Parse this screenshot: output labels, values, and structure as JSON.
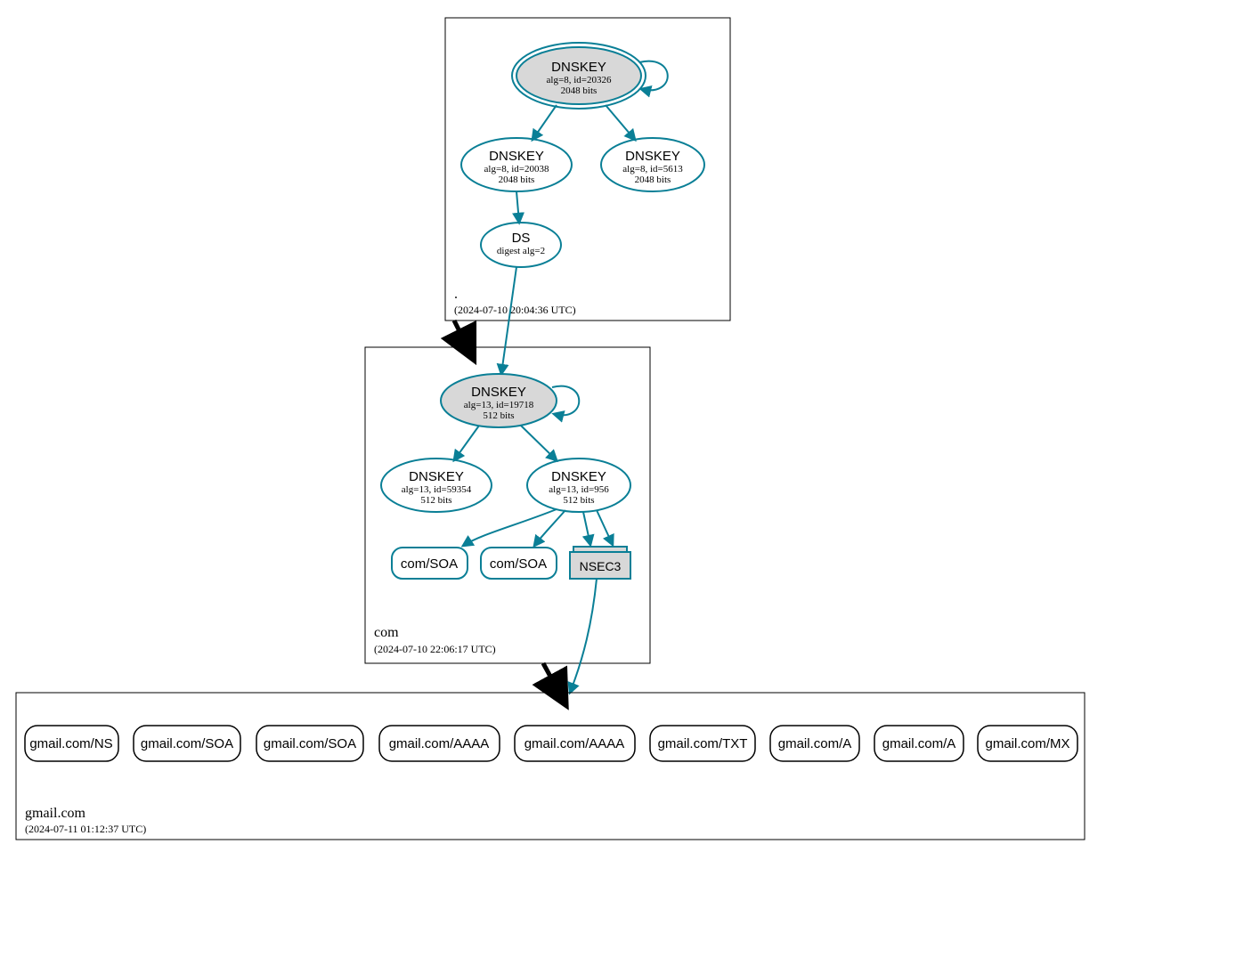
{
  "zones": {
    "root": {
      "label": ".",
      "timestamp": "(2024-07-10 20:04:36 UTC)"
    },
    "com": {
      "label": "com",
      "timestamp": "(2024-07-10 22:06:17 UTC)"
    },
    "gmail": {
      "label": "gmail.com",
      "timestamp": "(2024-07-11 01:12:37 UTC)"
    }
  },
  "nodes": {
    "root_ksk": {
      "title": "DNSKEY",
      "l1": "alg=8, id=20326",
      "l2": "2048 bits"
    },
    "root_zsk1": {
      "title": "DNSKEY",
      "l1": "alg=8, id=20038",
      "l2": "2048 bits"
    },
    "root_zsk2": {
      "title": "DNSKEY",
      "l1": "alg=8, id=5613",
      "l2": "2048 bits"
    },
    "root_ds": {
      "title": "DS",
      "l1": "digest alg=2"
    },
    "com_ksk": {
      "title": "DNSKEY",
      "l1": "alg=13, id=19718",
      "l2": "512 bits"
    },
    "com_zsk1": {
      "title": "DNSKEY",
      "l1": "alg=13, id=59354",
      "l2": "512 bits"
    },
    "com_zsk2": {
      "title": "DNSKEY",
      "l1": "alg=13, id=956",
      "l2": "512 bits"
    },
    "nsec3": {
      "title": "NSEC3"
    }
  },
  "rrsets_com": {
    "soa1": "com/SOA",
    "soa2": "com/SOA"
  },
  "rrsets_gmail": [
    "gmail.com/NS",
    "gmail.com/SOA",
    "gmail.com/SOA",
    "gmail.com/AAAA",
    "gmail.com/AAAA",
    "gmail.com/TXT",
    "gmail.com/A",
    "gmail.com/A",
    "gmail.com/MX"
  ]
}
